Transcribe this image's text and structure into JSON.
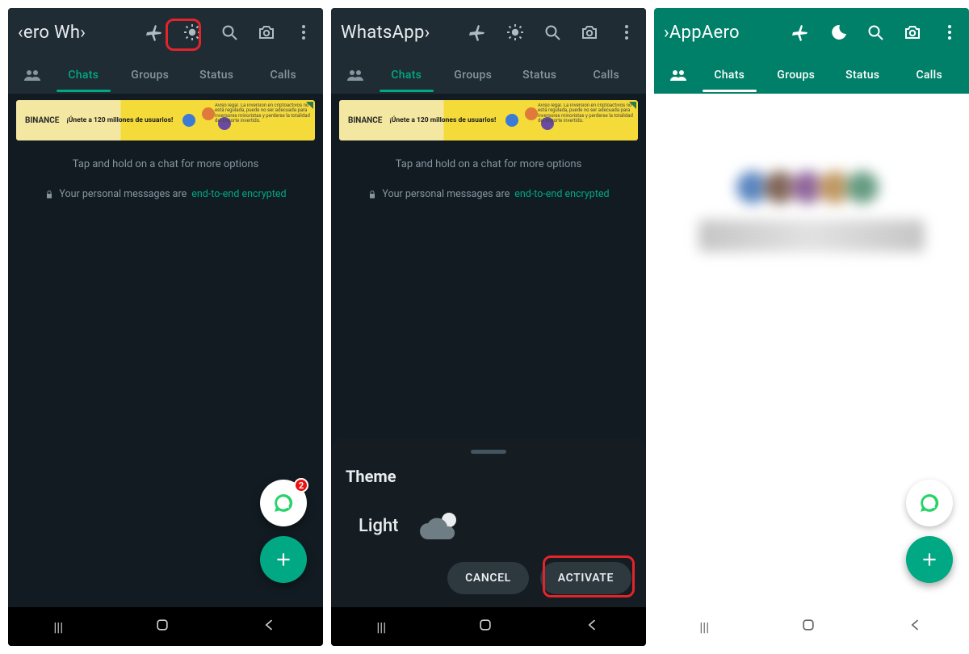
{
  "screens": {
    "s1": {
      "title": "‹ero     Wh›",
      "tabs": [
        "Chats",
        "Groups",
        "Status",
        "Calls"
      ],
      "hint": "Tap and hold on a chat for more options",
      "enc_prefix": "Your personal messages are ",
      "enc_link": "end-to-end encrypted",
      "ad_brand": "BINANCE",
      "ad_text": "¡Únete a 120 millones de usuarios!",
      "fab_badge": "2"
    },
    "s2": {
      "title": "WhatsApp›",
      "tabs": [
        "Chats",
        "Groups",
        "Status",
        "Calls"
      ],
      "hint": "Tap and hold on a chat for more options",
      "enc_prefix": "Your personal messages are ",
      "enc_link": "end-to-end encrypted",
      "ad_brand": "BINANCE",
      "ad_text": "¡Únete a 120 millones de usuarios!",
      "sheet_title": "Theme",
      "sheet_option": "Light",
      "btn_cancel": "CANCEL",
      "btn_activate": "ACTIVATE"
    },
    "s3": {
      "title": "›AppAero",
      "tabs": [
        "Chats",
        "Groups",
        "Status",
        "Calls"
      ]
    }
  }
}
